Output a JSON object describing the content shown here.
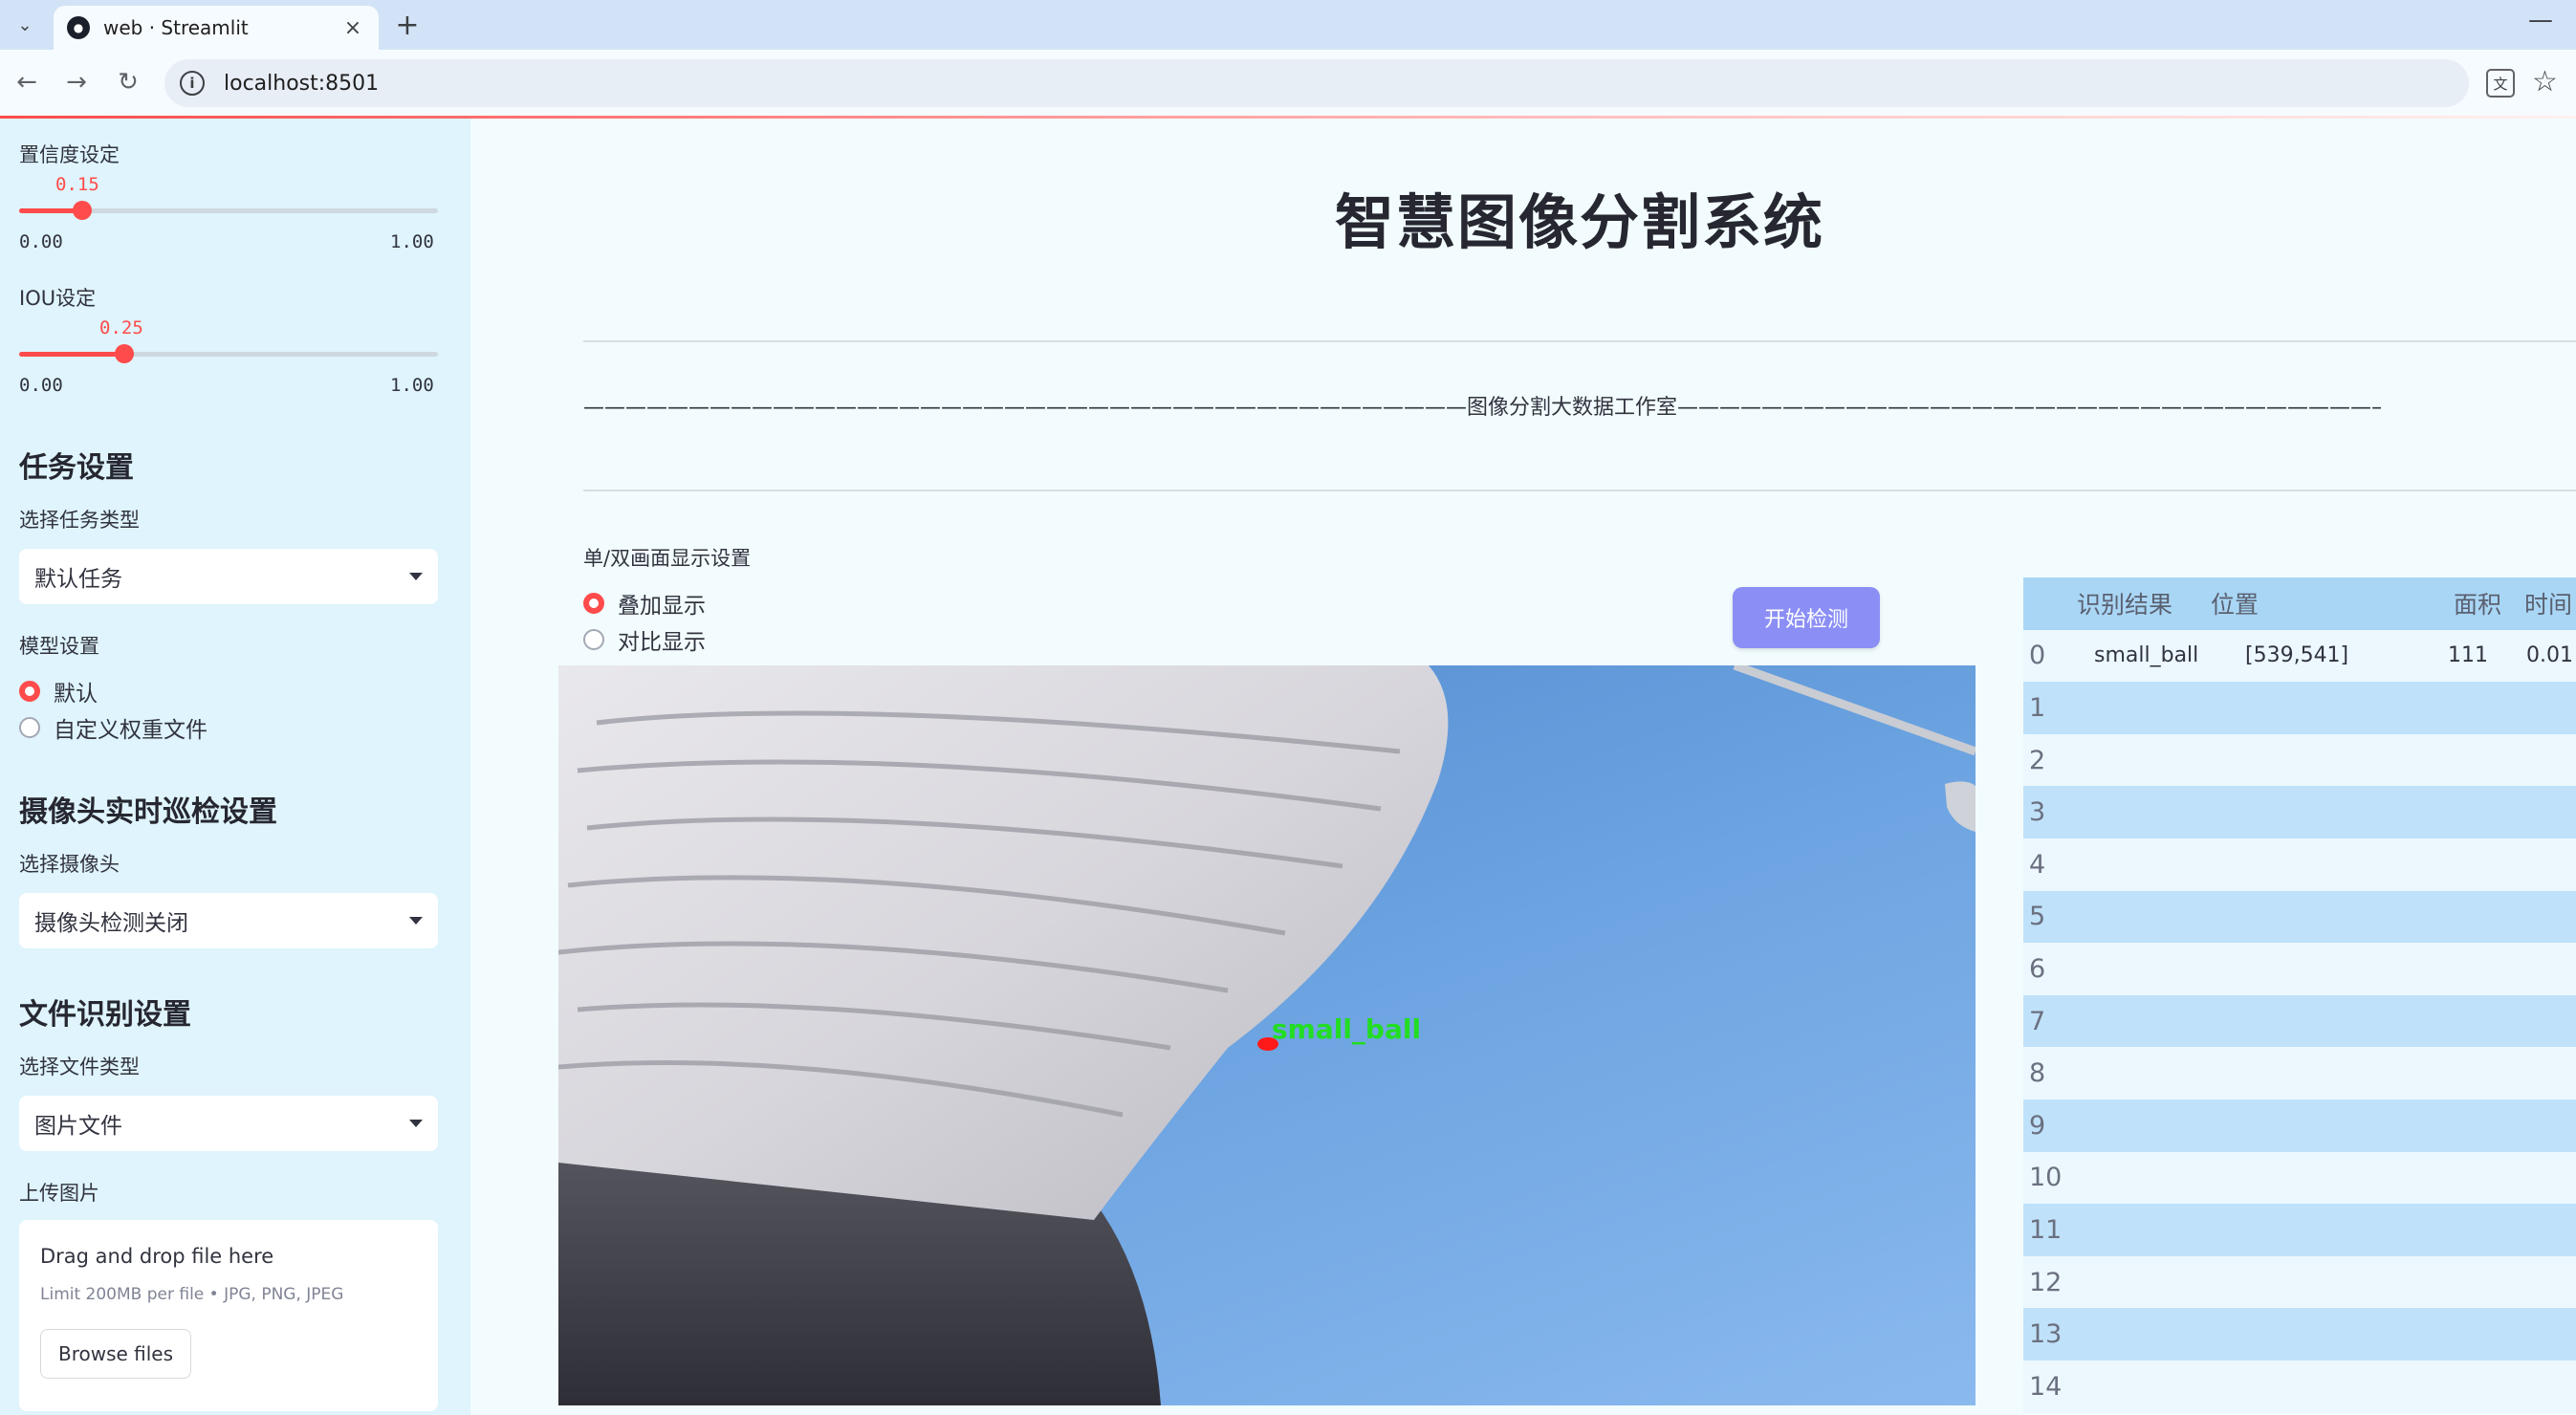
{
  "browser": {
    "tab_title": "web · Streamlit",
    "tab_close": "×",
    "new_tab": "+",
    "minimize": "—",
    "url": "localhost:8501",
    "icons": [
      "chevron-down-icon",
      "streamlit-icon",
      "close-icon",
      "plus-icon",
      "back-arrow-icon",
      "forward-arrow-icon",
      "reload-icon",
      "site-info-icon",
      "translate-icon",
      "star-icon"
    ]
  },
  "sidebar": {
    "confidence": {
      "label": "置信度设定",
      "value": "0.15",
      "value_fraction": 0.15,
      "min": "0.00",
      "max": "1.00"
    },
    "iou": {
      "label": "IOU设定",
      "value": "0.25",
      "value_fraction": 0.25,
      "min": "0.00",
      "max": "1.00"
    },
    "task_section": {
      "title": "任务设置",
      "select_label": "选择任务类型",
      "selected": "默认任务"
    },
    "model_section": {
      "label": "模型设置",
      "options": [
        "默认",
        "自定义权重文件"
      ],
      "selected_index": 0
    },
    "camera_section": {
      "title": "摄像头实时巡检设置",
      "select_label": "选择摄像头",
      "selected": "摄像头检测关闭"
    },
    "file_section": {
      "title": "文件识别设置",
      "select_label": "选择文件类型",
      "selected": "图片文件"
    },
    "upload": {
      "label": "上传图片",
      "drop_text": "Drag and drop file here",
      "limit_text": "Limit 200MB per file • JPG, PNG, JPEG",
      "button": "Browse files"
    }
  },
  "main": {
    "title": "智慧图像分割系统",
    "banner": "——————————————————————————————————————————图像分割大数据工作室——————————————————————————————————————————————",
    "display_mode": {
      "label": "单/双画面显示设置",
      "options": [
        "叠加显示",
        "对比显示"
      ],
      "selected_index": 0
    },
    "start_button": "开始检测",
    "detection_label": "small_ball",
    "colors": {
      "accent": "#ff4b4b",
      "button": "#8b8ff5",
      "table_header": "#a9d6f5",
      "table_stripe": "#bfe2fa"
    }
  },
  "results_table": {
    "columns": [
      "识别结果",
      "位置",
      "面积",
      "时间"
    ],
    "rows": [
      {
        "index": "0",
        "result": "small_ball",
        "position": "[539,541]",
        "area": "111",
        "time": "0.01"
      },
      {
        "index": "1",
        "result": "",
        "position": "",
        "area": "",
        "time": ""
      },
      {
        "index": "2",
        "result": "",
        "position": "",
        "area": "",
        "time": ""
      },
      {
        "index": "3",
        "result": "",
        "position": "",
        "area": "",
        "time": ""
      },
      {
        "index": "4",
        "result": "",
        "position": "",
        "area": "",
        "time": ""
      },
      {
        "index": "5",
        "result": "",
        "position": "",
        "area": "",
        "time": ""
      },
      {
        "index": "6",
        "result": "",
        "position": "",
        "area": "",
        "time": ""
      },
      {
        "index": "7",
        "result": "",
        "position": "",
        "area": "",
        "time": ""
      },
      {
        "index": "8",
        "result": "",
        "position": "",
        "area": "",
        "time": ""
      },
      {
        "index": "9",
        "result": "",
        "position": "",
        "area": "",
        "time": ""
      },
      {
        "index": "10",
        "result": "",
        "position": "",
        "area": "",
        "time": ""
      },
      {
        "index": "11",
        "result": "",
        "position": "",
        "area": "",
        "time": ""
      },
      {
        "index": "12",
        "result": "",
        "position": "",
        "area": "",
        "time": ""
      },
      {
        "index": "13",
        "result": "",
        "position": "",
        "area": "",
        "time": ""
      },
      {
        "index": "14",
        "result": "",
        "position": "",
        "area": "",
        "time": ""
      }
    ]
  }
}
